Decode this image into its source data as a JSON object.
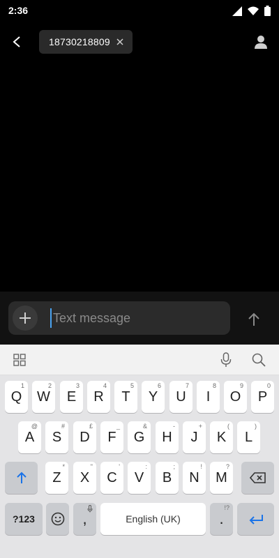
{
  "status_bar": {
    "time": "2:36"
  },
  "conversation": {
    "recipient": "18730218809"
  },
  "compose": {
    "placeholder": "Text message"
  },
  "keyboard": {
    "row1": [
      {
        "key": "Q",
        "hint": "1"
      },
      {
        "key": "W",
        "hint": "2"
      },
      {
        "key": "E",
        "hint": "3"
      },
      {
        "key": "R",
        "hint": "4"
      },
      {
        "key": "T",
        "hint": "5"
      },
      {
        "key": "Y",
        "hint": "6"
      },
      {
        "key": "U",
        "hint": "7"
      },
      {
        "key": "I",
        "hint": "8"
      },
      {
        "key": "O",
        "hint": "9"
      },
      {
        "key": "P",
        "hint": "0"
      }
    ],
    "row2": [
      {
        "key": "A",
        "hint": "@"
      },
      {
        "key": "S",
        "hint": "#"
      },
      {
        "key": "D",
        "hint": "£"
      },
      {
        "key": "F",
        "hint": "_"
      },
      {
        "key": "G",
        "hint": "&"
      },
      {
        "key": "H",
        "hint": "-"
      },
      {
        "key": "J",
        "hint": "+"
      },
      {
        "key": "K",
        "hint": "("
      },
      {
        "key": "L",
        "hint": ")"
      }
    ],
    "row3": [
      {
        "key": "Z",
        "hint": "*"
      },
      {
        "key": "X",
        "hint": "\""
      },
      {
        "key": "C",
        "hint": "'"
      },
      {
        "key": "V",
        "hint": ":"
      },
      {
        "key": "B",
        "hint": ";"
      },
      {
        "key": "N",
        "hint": "!"
      },
      {
        "key": "M",
        "hint": "?"
      }
    ],
    "symbols_label": "?123",
    "comma": ",",
    "period": ".",
    "period_hint": "!?",
    "space_label": "English (UK)"
  }
}
